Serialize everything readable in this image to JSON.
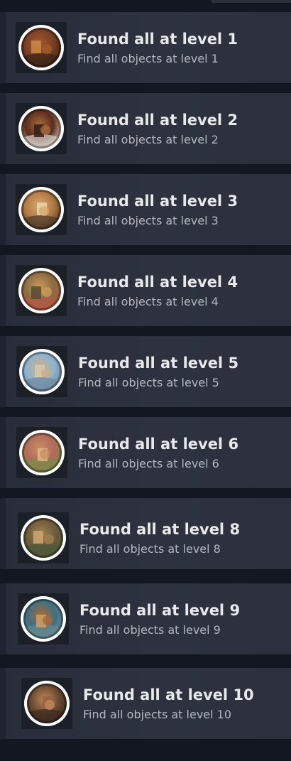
{
  "achievements": [
    {
      "title": "Found all at level 1",
      "description": "Find all objects at level 1",
      "icon": "level-1-scene-icon",
      "colors": [
        "#7a3f24",
        "#a05a2c",
        "#3b2416",
        "#c98a4a"
      ]
    },
    {
      "title": "Found all at level 2",
      "description": "Find all objects at level 2",
      "icon": "level-2-scene-icon",
      "colors": [
        "#5a2c1c",
        "#a76a3e",
        "#d9d2c8",
        "#2e1f18"
      ]
    },
    {
      "title": "Found all at level 3",
      "description": "Find all objects at level 3",
      "icon": "level-3-scene-icon",
      "colors": [
        "#b07a45",
        "#d9a86a",
        "#4e3b2a",
        "#e8d3b0"
      ]
    },
    {
      "title": "Found all at level 4",
      "description": "Find all objects at level 4",
      "icon": "level-4-scene-icon",
      "colors": [
        "#8a6c42",
        "#c99a5a",
        "#b55a46",
        "#5b4a31"
      ]
    },
    {
      "title": "Found all at level 5",
      "description": "Find all objects at level 5",
      "icon": "level-5-scene-icon",
      "colors": [
        "#8fb3cf",
        "#c9b089",
        "#6e8aa0",
        "#d8c9ad"
      ]
    },
    {
      "title": "Found all at level 6",
      "description": "Find all objects at level 6",
      "icon": "level-6-scene-icon",
      "colors": [
        "#b06c5a",
        "#c98f63",
        "#7a8a4a",
        "#e0b98a"
      ]
    },
    {
      "title": "Found all at level 8",
      "description": "Find all objects at level 8",
      "icon": "level-8-scene-icon",
      "colors": [
        "#6f5a3c",
        "#a08250",
        "#4a5a3a",
        "#c9a870"
      ]
    },
    {
      "title": "Found all at level 9",
      "description": "Find all objects at level 9",
      "icon": "level-9-scene-icon",
      "colors": [
        "#3f6f80",
        "#a86a3a",
        "#6a8a8f",
        "#d0a060"
      ]
    },
    {
      "title": "Found all at level 10",
      "description": "Find all objects at level 10",
      "icon": "level-10-scene-icon",
      "colors": [
        "#6a4a30",
        "#c08a5a",
        "#3a2a20",
        "#9a6040"
      ]
    }
  ]
}
